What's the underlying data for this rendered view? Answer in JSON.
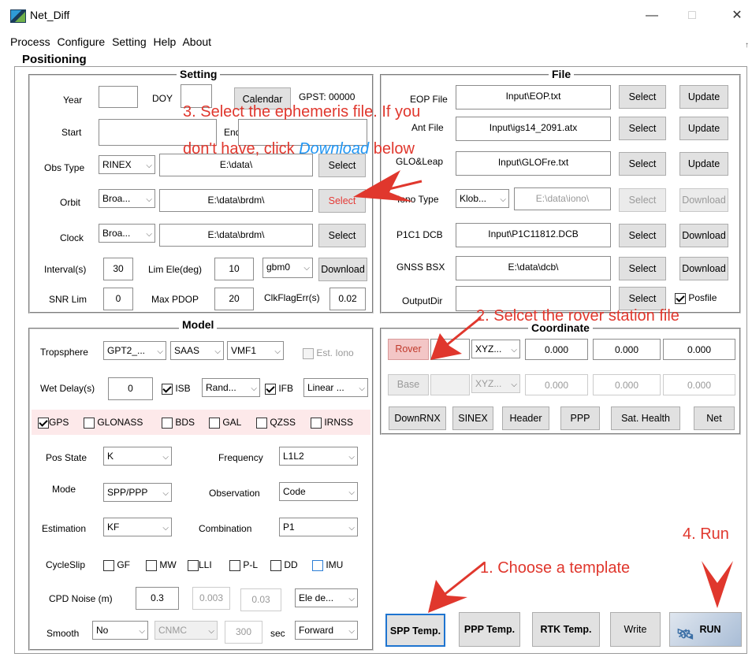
{
  "window": {
    "title": "Net_Diff",
    "minimize": "—",
    "maximize": "□",
    "close": "✕"
  },
  "menu": [
    "Process",
    "Configure",
    "Setting",
    "Help",
    "About"
  ],
  "tab": "Positioning",
  "setting": {
    "title": "Setting",
    "year_label": "Year",
    "year_value": "",
    "doy_label": "DOY",
    "doy_value": "",
    "calendar": "Calendar",
    "gpst": "GPST: 00000",
    "start_label": "Start",
    "end_label": "End",
    "obs_type_label": "Obs Type",
    "obs_type": "RINEX",
    "obs_path": "E:\\data\\",
    "obs_select": "Select",
    "orbit_label": "Orbit",
    "orbit_type": "Broa...",
    "orbit_path": "E:\\data\\brdm\\",
    "orbit_select": "Select",
    "clock_label": "Clock",
    "clock_type": "Broa...",
    "clock_path": "E:\\data\\brdm\\",
    "clock_select": "Select",
    "interval_label": "Interval(s)",
    "interval": "30",
    "limele_label": "Lim Ele(deg)",
    "limele": "10",
    "center": "gbm0",
    "download": "Download",
    "snr_label": "SNR Lim",
    "snr": "0",
    "pdop_label": "Max PDOP",
    "pdop": "20",
    "clkflag_label": "ClkFlagErr(s)",
    "clkflag": "0.02"
  },
  "file": {
    "title": "File",
    "eop_label": "EOP File",
    "eop": "Input\\EOP.txt",
    "ant_label": "Ant File",
    "ant": "Input\\igs14_2091.atx",
    "glo_label": "GLO&Leap",
    "glo": "Input\\GLOFre.txt",
    "iono_label": "Iono Type",
    "iono_type": "Klob...",
    "iono_path": "E:\\data\\iono\\",
    "p1c1_label": "P1C1 DCB",
    "p1c1": "Input\\P1C11812.DCB",
    "gnss_label": "GNSS BSX",
    "gnss": "E:\\data\\dcb\\",
    "output_label": "OutputDir",
    "output": "",
    "select": "Select",
    "update": "Update",
    "download": "Download",
    "posfile": "Posfile"
  },
  "coordinate": {
    "title": "Coordinate",
    "rover": "Rover",
    "rover_name": "",
    "rover_type": "XYZ...",
    "rover_x": "0.000",
    "rover_y": "0.000",
    "rover_z": "0.000",
    "base": "Base",
    "base_name": "",
    "base_type": "XYZ...",
    "base_x": "0.000",
    "base_y": "0.000",
    "base_z": "0.000",
    "buttons": [
      "DownRNX",
      "SINEX",
      "Header",
      "PPP",
      "Sat. Health",
      "Net"
    ]
  },
  "model": {
    "title": "Model",
    "tropo_label": "Tropsphere",
    "tropo1": "GPT2_...",
    "tropo2": "SAAS",
    "tropo3": "VMF1",
    "est_iono": "Est. Iono",
    "wet_label": "Wet Delay(s)",
    "wet": "0",
    "isb": "ISB",
    "isb_type": "Rand...",
    "ifb": "IFB",
    "ifb_type": "Linear ...",
    "gps": "GPS",
    "glonass": "GLONASS",
    "bds": "BDS",
    "gal": "GAL",
    "qzss": "QZSS",
    "irnss": "IRNSS",
    "posstate_label": "Pos State",
    "posstate": "K",
    "freq_label": "Frequency",
    "freq": "L1L2",
    "mode_label": "Mode",
    "mode": "SPP/PPP",
    "obs_label": "Observation",
    "obs": "Code",
    "est_label": "Estimation",
    "est": "KF",
    "comb_label": "Combination",
    "comb": "P1",
    "cs_label": "CycleSlip",
    "gf": "GF",
    "mw": "MW",
    "lli": "LLI",
    "pl": "P-L",
    "dd": "DD",
    "imu": "IMU",
    "cpd_label": "CPD Noise (m)",
    "cpd1": "0.3",
    "cpd2": "0.003",
    "cpd3": "0.03",
    "ele": "Ele de...",
    "smooth_label": "Smooth",
    "smooth": "No",
    "cnmc": "CNMC",
    "smooth_val": "300",
    "sec": "sec",
    "direction": "Forward"
  },
  "bottom": {
    "spp": "SPP Temp.",
    "ppp": "PPP Temp.",
    "rtk": "RTK Temp.",
    "write": "Write",
    "run": "RUN"
  },
  "annotations": {
    "a3_line1": "3. Select the ephemeris file. If you",
    "a3_line2a": "don't have, click ",
    "a3_line2b": "Download",
    "a3_line2c": " below",
    "a2": "2. Selcet the rover station file",
    "a1": "1. Choose a template",
    "a4": "4. Run"
  },
  "colors": {
    "annotation": "#e0372d",
    "link": "#2196f3",
    "highlight_row": "#fde9ea",
    "rover_bg": "#f3c6c6",
    "run_bg": "#b9c9de"
  }
}
